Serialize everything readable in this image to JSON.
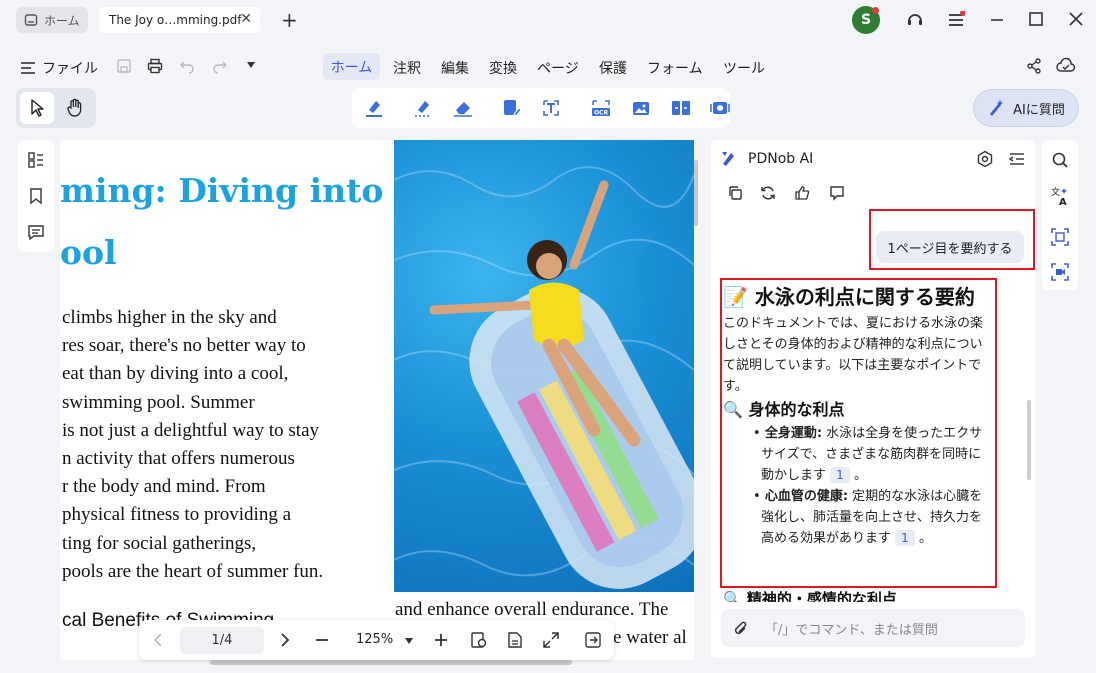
{
  "tabs": {
    "home_label": "ホーム",
    "doc_label": "The Joy o…mming.pdf",
    "close_glyph": "✕",
    "new_glyph": "+"
  },
  "user": {
    "initial": "S"
  },
  "menu": {
    "file_label": "ファイル",
    "items": [
      "ホーム",
      "注釈",
      "編集",
      "変換",
      "ページ",
      "保護",
      "フォーム",
      "ツール"
    ]
  },
  "toolbar": {
    "ai_button_label": "AIに質問"
  },
  "document": {
    "title_lines": [
      "ming: Diving into",
      "ool"
    ],
    "body_lines": [
      "climbs higher in the sky and",
      "res soar, there's no better way to",
      "eat than by diving into a cool,",
      "swimming pool. Summer",
      "is not just a delightful way to stay",
      "n activity that offers numerous",
      "r the body and mind. From",
      "physical fitness to providing a",
      "ting for social gatherings,",
      "pools are the heart of summer fun."
    ],
    "subheading": "cal Benefits of Swimming",
    "right_lines": [
      "and enhance overall endurance. The",
      "e water al"
    ]
  },
  "nav": {
    "page": "1/4",
    "zoom": "125%"
  },
  "ai": {
    "title": "PDNob AI",
    "prompt": "1ページ目を要約する",
    "answer": {
      "heading_icon": "📝",
      "heading": "水泳の利点に関する要約",
      "intro": "このドキュメントでは、夏における水泳の楽しさとその身体的および精神的な利点について説明しています。以下は主要なポイントです。",
      "section1_icon": "🔍",
      "section1": "身体的な利点",
      "bullets": [
        {
          "bold": "全身運動:",
          "text": " 水泳は全身を使ったエクササイズで、さまざまな筋肉群を同時に動かします",
          "ref": "1",
          "tail": "。"
        },
        {
          "bold": "心血管の健康:",
          "text": " 定期的な水泳は心臓を強化し、肺活量を向上させ、持久力を高める効果があります",
          "ref": "1",
          "tail": "。"
        }
      ],
      "section2_icon": "🔍",
      "section2": "精神的・感情的な利点"
    },
    "input_placeholder": "「/」でコマンド、または質問"
  },
  "colors": {
    "accent": "#3b5bd9",
    "title_blue": "#1aa3e0",
    "highlight_red": "#e8141b"
  }
}
